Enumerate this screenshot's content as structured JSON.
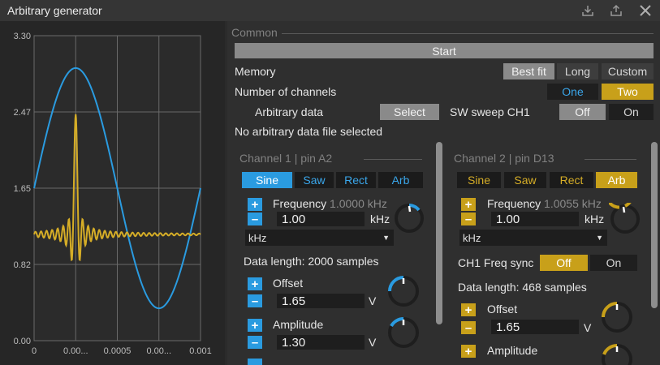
{
  "window": {
    "title": "Arbitrary generator",
    "icons": [
      "download-icon",
      "share-icon",
      "close-icon"
    ]
  },
  "chart_data": {
    "type": "line",
    "title": "",
    "xlabel": "",
    "ylabel": "",
    "xlim": [
      0,
      0.001
    ],
    "ylim": [
      0,
      3.3
    ],
    "x_ticks": [
      "0",
      "0.00...",
      "0.0005",
      "0.00...",
      "0.001"
    ],
    "y_ticks": [
      "3.30",
      "2.47",
      "1.65",
      "0.82",
      "0.00"
    ],
    "grid": true,
    "series": [
      {
        "color": "#2a9be0",
        "kind": "sine",
        "offset": 1.65,
        "amplitude": 1.3,
        "cycles": 1.0
      },
      {
        "color": "#d5ad27",
        "kind": "sinc",
        "center_x": 0.00025,
        "offset": 1.15,
        "peak": 2.45,
        "min": 0.85
      }
    ]
  },
  "common": {
    "section_label": "Common",
    "start_label": "Start",
    "memory_label": "Memory",
    "memory_options": [
      "Best fit",
      "Long",
      "Custom"
    ],
    "channels_label": "Number of channels",
    "channels_options": [
      "One",
      "Two"
    ],
    "arb_label": "Arbitrary data",
    "select_label": "Select",
    "sweep_label": "SW sweep CH1",
    "sweep_options": [
      "Off",
      "On"
    ],
    "no_file": "No arbitrary data file selected"
  },
  "ch1": {
    "title": "Channel 1 | pin A2",
    "waves": [
      "Sine",
      "Saw",
      "Rect",
      "Arb"
    ],
    "freq_label": "Frequency",
    "freq_readout": "1.0000 kHz",
    "freq_value": "1.00",
    "freq_unit": "kHz",
    "unit_select": "kHz",
    "data_length": "Data length: 2000 samples",
    "offset_label": "Offset",
    "offset_value": "1.65",
    "offset_unit": "V",
    "amp_label": "Amplitude",
    "amp_value": "1.30",
    "amp_unit": "V",
    "accent": "#2a9be0"
  },
  "ch2": {
    "title": "Channel 2 | pin D13",
    "waves": [
      "Sine",
      "Saw",
      "Rect",
      "Arb"
    ],
    "freq_label": "Frequency",
    "freq_readout": "1.0055 kHz",
    "freq_value": "1.00",
    "freq_unit": "kHz",
    "unit_select": "kHz",
    "sync_label": "CH1 Freq sync",
    "sync_options": [
      "Off",
      "On"
    ],
    "data_length": "Data length: 468 samples",
    "offset_label": "Offset",
    "offset_value": "1.65",
    "offset_unit": "V",
    "amp_label": "Amplitude",
    "accent": "#c8a01a"
  }
}
